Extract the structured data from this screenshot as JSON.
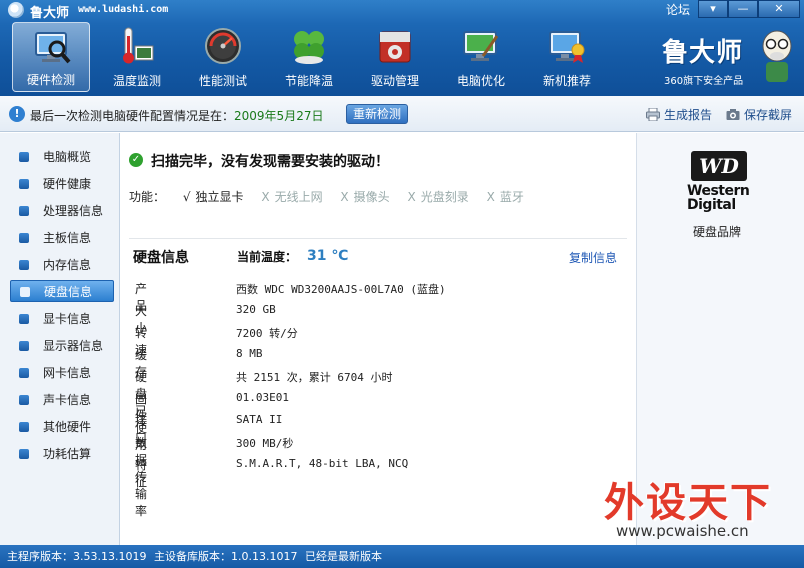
{
  "window": {
    "title": "鲁大师",
    "url": "www.ludashi.com",
    "forum_link": "论坛",
    "btn_menu": "▾",
    "btn_min": "—",
    "btn_close": "✕"
  },
  "toolbar": {
    "items": [
      {
        "label": "硬件检测",
        "icon": "monitor-magnifier-icon",
        "active": true
      },
      {
        "label": "温度监测",
        "icon": "thermometer-icon",
        "active": false
      },
      {
        "label": "性能测试",
        "icon": "speedometer-icon",
        "active": false
      },
      {
        "label": "节能降温",
        "icon": "clover-icon",
        "active": false
      },
      {
        "label": "驱动管理",
        "icon": "gear-box-icon",
        "active": false
      },
      {
        "label": "电脑优化",
        "icon": "monitor-broom-icon",
        "active": false
      },
      {
        "label": "新机推荐",
        "icon": "monitor-medal-icon",
        "active": false
      }
    ]
  },
  "brand": {
    "name": "鲁大师",
    "subtitle": "360旗下安全产品"
  },
  "infobar": {
    "prefix": "最后一次检测电脑硬件配置情况是在：",
    "date": "2009年5月27日",
    "redetect": "重新检测",
    "report": "生成报告",
    "screenshot": "保存截屏"
  },
  "sidebar": {
    "items": [
      {
        "label": "电脑概览",
        "active": false
      },
      {
        "label": "硬件健康",
        "active": false
      },
      {
        "label": "处理器信息",
        "active": false
      },
      {
        "label": "主板信息",
        "active": false
      },
      {
        "label": "内存信息",
        "active": false
      },
      {
        "label": "硬盘信息",
        "active": true
      },
      {
        "label": "显卡信息",
        "active": false
      },
      {
        "label": "显示器信息",
        "active": false
      },
      {
        "label": "网卡信息",
        "active": false
      },
      {
        "label": "声卡信息",
        "active": false
      },
      {
        "label": "其他硬件",
        "active": false
      },
      {
        "label": "功耗估算",
        "active": false
      }
    ]
  },
  "main": {
    "scan_message": "扫描完毕，没有发现需要安装的驱动！",
    "features_label": "功能：",
    "features": [
      {
        "mark": "√",
        "label": "独立显卡",
        "enabled": true
      },
      {
        "mark": "X",
        "label": "无线上网",
        "enabled": false
      },
      {
        "mark": "X",
        "label": "摄像头",
        "enabled": false
      },
      {
        "mark": "X",
        "label": "光盘刻录",
        "enabled": false
      },
      {
        "mark": "X",
        "label": "蓝牙",
        "enabled": false
      }
    ],
    "section_title": "硬盘信息",
    "temp_label": "当前温度：",
    "temp_value": "31 ℃",
    "copy_info": "复制信息",
    "rows": [
      {
        "key": "产品",
        "value": "西数 WDC WD3200AAJS-00L7A0 (蓝盘)"
      },
      {
        "key": "大小",
        "value": "320 GB"
      },
      {
        "key": "转速",
        "value": "7200 转/分"
      },
      {
        "key": "缓存",
        "value": "8 MB"
      },
      {
        "key": "硬盘已使用",
        "value": "共 2151 次，累计 6704 小时"
      },
      {
        "key": "固件",
        "value": "01.03E01"
      },
      {
        "key": "接口",
        "value": "SATA II"
      },
      {
        "key": "数据传输率",
        "value": "300 MB/秒"
      },
      {
        "key": "特征",
        "value": "S.M.A.R.T,  48-bit LBA,  NCQ"
      }
    ]
  },
  "right": {
    "logo_text": "WD",
    "name_line1": "Western",
    "name_line2": "Digital",
    "caption": "硬盘品牌"
  },
  "watermark": {
    "text": "外设天下",
    "url": "www.pcwaishe.cn"
  },
  "status": {
    "main_version": "主程序版本：3.53.13.1019",
    "db_version": "主设备库版本：1.0.13.1017",
    "latest": "已经是最新版本"
  }
}
